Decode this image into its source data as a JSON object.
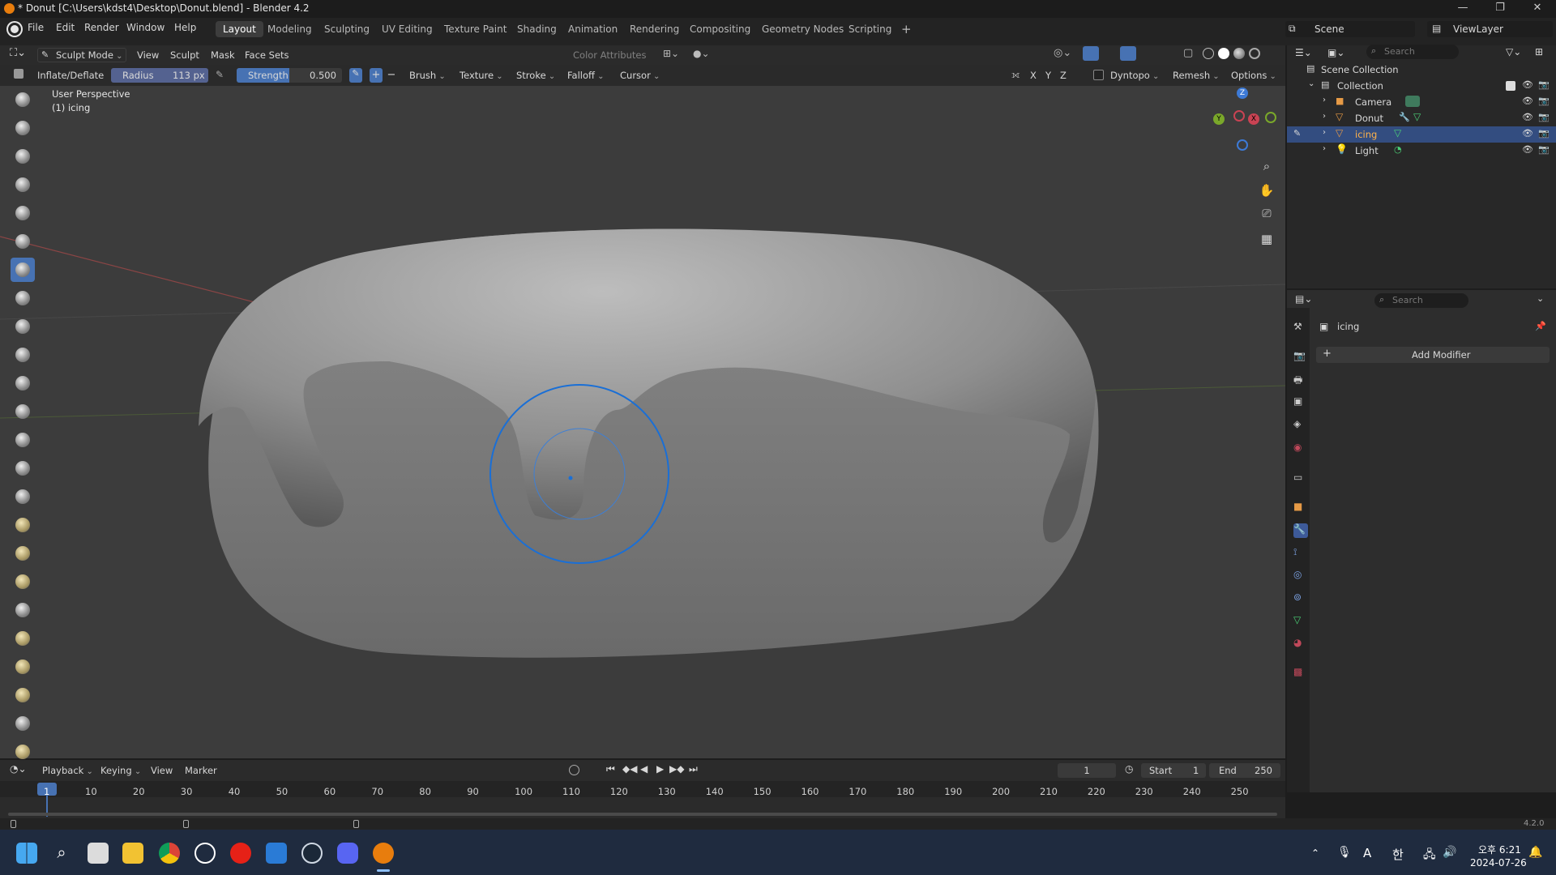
{
  "window": {
    "title": "* Donut [C:\\Users\\kdst4\\Desktop\\Donut.blend] - Blender 4.2"
  },
  "menus": [
    "File",
    "Edit",
    "Render",
    "Window",
    "Help"
  ],
  "workspaces": [
    "Layout",
    "Modeling",
    "Sculpting",
    "UV Editing",
    "Texture Paint",
    "Shading",
    "Animation",
    "Rendering",
    "Compositing",
    "Geometry Nodes",
    "Scripting"
  ],
  "scene": {
    "name": "Scene",
    "view_layer": "ViewLayer"
  },
  "header": {
    "mode": "Sculpt Mode",
    "menus": [
      "View",
      "Sculpt",
      "Mask",
      "Face Sets"
    ],
    "color_attributes": "Color Attributes"
  },
  "tool_settings": {
    "brush_name": "Inflate/Deflate",
    "radius_label": "Radius",
    "radius_value": "113 px",
    "strength_label": "Strength",
    "strength_value": "0.500",
    "dropdowns": [
      "Brush",
      "Texture",
      "Stroke",
      "Falloff",
      "Cursor"
    ],
    "axes": [
      "X",
      "Y",
      "Z"
    ],
    "dyntopo": "Dyntopo",
    "remesh": "Remesh",
    "options": "Options"
  },
  "viewport": {
    "perspective": "User Perspective",
    "object": "(1) icing",
    "gizmo": {
      "z": "Z",
      "y": "Y",
      "x": "X"
    }
  },
  "outliner": {
    "search_placeholder": "Search",
    "root": "Scene Collection",
    "collection": "Collection",
    "items": [
      {
        "name": "Camera",
        "selected": false
      },
      {
        "name": "Donut",
        "selected": false
      },
      {
        "name": "icing",
        "selected": true
      },
      {
        "name": "Light",
        "selected": false
      }
    ]
  },
  "properties": {
    "search_placeholder": "Search",
    "object_name": "icing",
    "add_modifier": "Add Modifier"
  },
  "timeline": {
    "menus": [
      "Playback",
      "Keying",
      "View",
      "Marker"
    ],
    "current_frame": "1",
    "start_label": "Start",
    "start_value": "1",
    "end_label": "End",
    "end_value": "250",
    "ticks": [
      "1",
      "10",
      "20",
      "30",
      "40",
      "50",
      "60",
      "70",
      "80",
      "90",
      "100",
      "110",
      "120",
      "130",
      "140",
      "150",
      "160",
      "170",
      "180",
      "190",
      "200",
      "210",
      "220",
      "230",
      "240",
      "250"
    ]
  },
  "status": {
    "version": "4.2.0"
  },
  "taskbar": {
    "ime": "A",
    "hangul": "한",
    "time": "오후 6:21",
    "date": "2024-07-26"
  },
  "colors": {
    "accent": "#4772b3",
    "brush_circle": "#1a6fd6"
  }
}
